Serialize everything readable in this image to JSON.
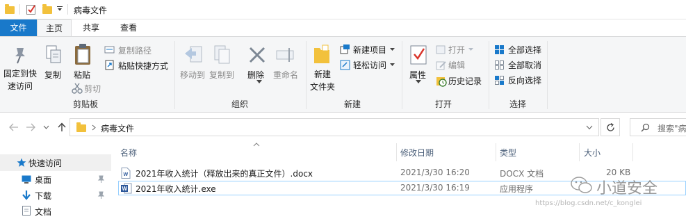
{
  "window": {
    "title": "病毒文件"
  },
  "tabs": [
    {
      "label": "文件"
    },
    {
      "label": "主页"
    },
    {
      "label": "共享"
    },
    {
      "label": "查看"
    }
  ],
  "ribbon": {
    "clipboard": {
      "group_label": "剪贴板",
      "pin_label_1": "固定到快",
      "pin_label_2": "速访问",
      "copy_label": "复制",
      "paste_label": "粘贴",
      "copy_path_label": "复制路径",
      "paste_shortcut_label": "粘贴快捷方式",
      "cut_label": "剪切"
    },
    "organize": {
      "group_label": "组织",
      "move_to_label": "移动到",
      "copy_to_label": "复制到",
      "delete_label": "删除",
      "rename_label": "重命名"
    },
    "new": {
      "group_label": "新建",
      "new_folder_label_1": "新建",
      "new_folder_label_2": "文件夹",
      "new_item_label": "新建项目",
      "easy_access_label": "轻松访问"
    },
    "open": {
      "group_label": "打开",
      "properties_label": "属性",
      "open_label": "打开",
      "edit_label": "编辑",
      "history_label": "历史记录"
    },
    "select": {
      "group_label": "选择",
      "select_all_label": "全部选择",
      "select_none_label": "全部取消",
      "invert_label": "反向选择"
    }
  },
  "address": {
    "path": "病毒文件",
    "search_placeholder": "搜索\"病"
  },
  "nav": [
    {
      "label": "快速访问"
    },
    {
      "label": "桌面"
    },
    {
      "label": "下载"
    },
    {
      "label": "文档"
    }
  ],
  "columns": {
    "name": "名称",
    "modified": "修改日期",
    "type": "类型",
    "size": "大小"
  },
  "files": [
    {
      "name": "2021年收入统计（释放出来的真正文件）.docx",
      "modified": "2021/3/30 16:20",
      "type": "DOCX 文档",
      "size": "20 KB",
      "icon": "word-doc-icon"
    },
    {
      "name": "2021年收入统计.exe",
      "modified": "2021/3/30 16:19",
      "type": "应用程序",
      "size": "",
      "icon": "word-exe-icon"
    }
  ],
  "watermark": {
    "brand": "小道安全",
    "url": "https://blog.csdn.net/c_konglei"
  },
  "colors": {
    "file_tab": "#1979ca",
    "ribbon_bg": "#f5f6f7",
    "folder": "#f2c13c",
    "selected_row_border": "#99d1ff"
  }
}
